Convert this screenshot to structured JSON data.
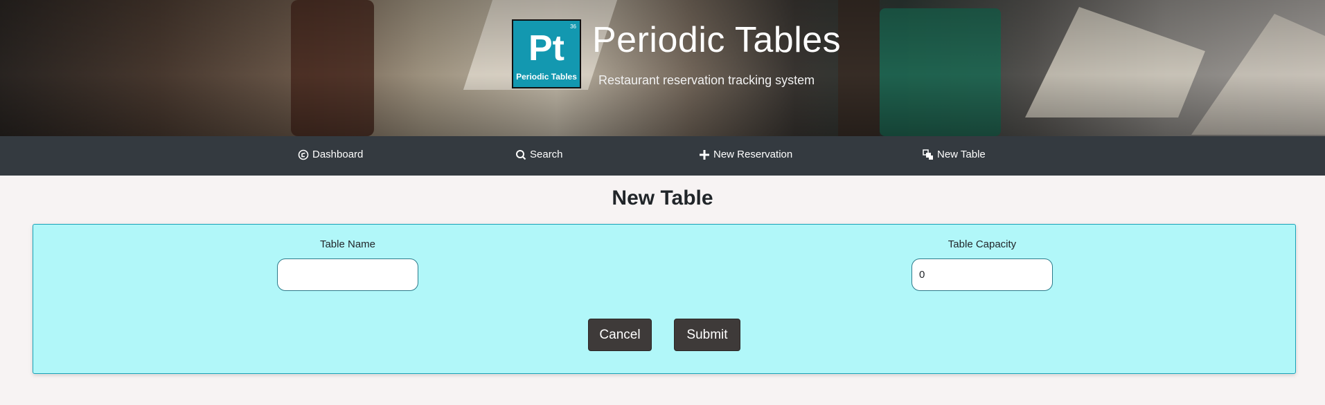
{
  "header": {
    "logo_number": "36",
    "logo_symbol": "Pt",
    "logo_caption": "Periodic Tables",
    "title": "Periodic Tables",
    "subtitle": "Restaurant reservation tracking system"
  },
  "nav": {
    "items": [
      {
        "label": "Dashboard",
        "icon": "dashboard-icon"
      },
      {
        "label": "Search",
        "icon": "search-icon"
      },
      {
        "label": "New Reservation",
        "icon": "plus-icon"
      },
      {
        "label": "New Table",
        "icon": "new-table-icon"
      }
    ],
    "background": "#343a40"
  },
  "main": {
    "title": "New Table",
    "form": {
      "table_name_label": "Table Name",
      "table_name_value": "",
      "capacity_label": "Table Capacity",
      "capacity_value": "0",
      "cancel_label": "Cancel",
      "submit_label": "Submit"
    }
  },
  "colors": {
    "form_background": "#b1f7f9",
    "form_border": "#17a2b8",
    "button": "#3e3a39",
    "logo": "#1398b0",
    "page_background": "#f7f3f3"
  }
}
